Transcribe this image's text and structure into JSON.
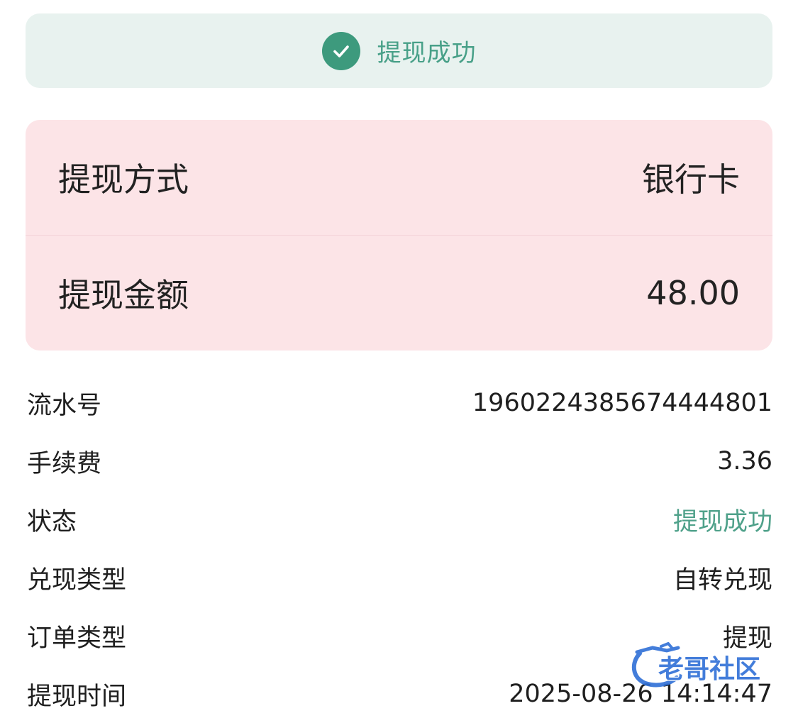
{
  "banner": {
    "text": "提现成功",
    "icon": "check-circle-icon",
    "accent_color": "#3d9a7d"
  },
  "summary": {
    "method_label": "提现方式",
    "method_value": "银行卡",
    "amount_label": "提现金额",
    "amount_value": "48.00"
  },
  "details": {
    "serial_label": "流水号",
    "serial_value": "1960224385674444801",
    "fee_label": "手续费",
    "fee_value": "3.36",
    "status_label": "状态",
    "status_value": "提现成功",
    "status_color": "#4fa18a",
    "exchange_type_label": "兑现类型",
    "exchange_type_value": "自转兑现",
    "order_type_label": "订单类型",
    "order_type_value": "提现",
    "time_label": "提现时间",
    "time_value": "2025-08-26 14:14:47"
  },
  "watermark": {
    "text": "老哥社区",
    "icon": "dragon-logo-icon"
  }
}
